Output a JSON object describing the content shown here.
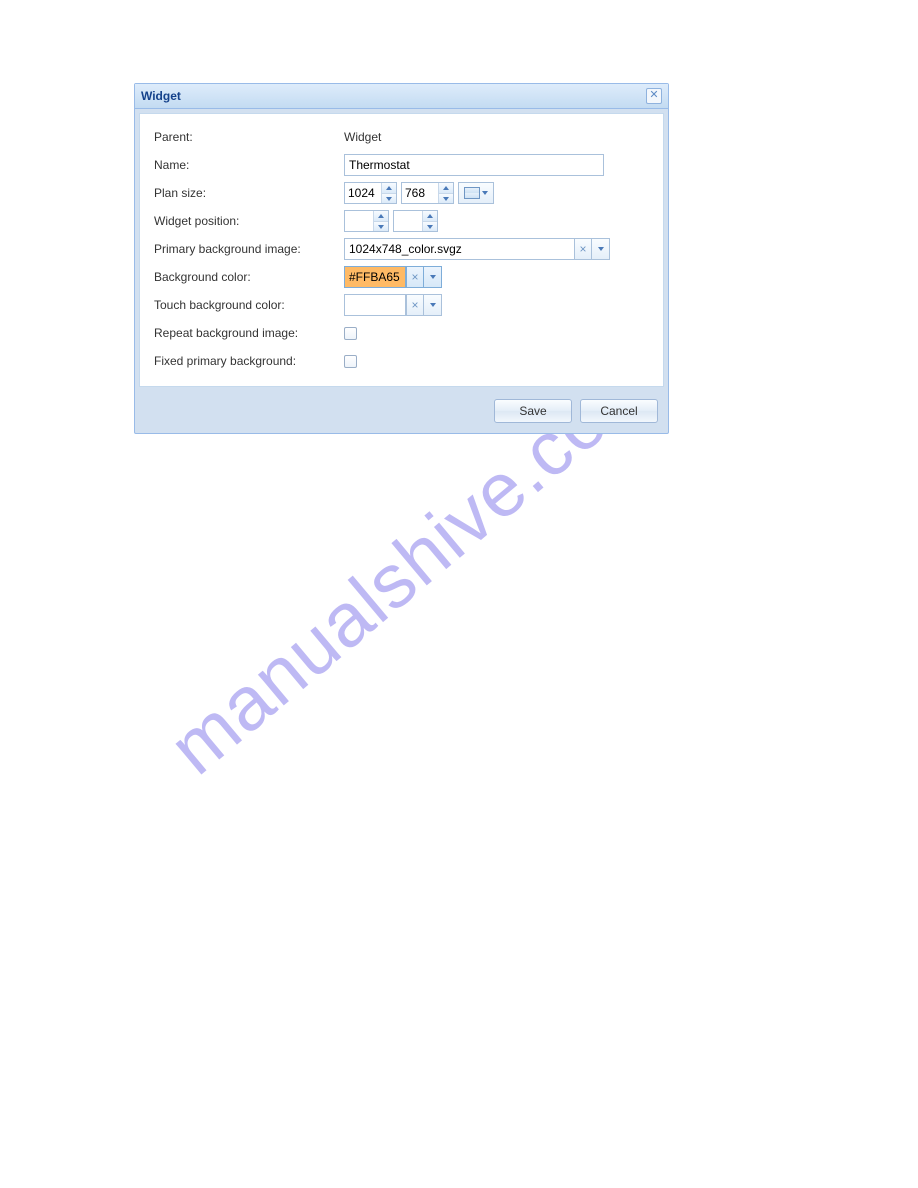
{
  "watermark": "manualshive.com",
  "dialog": {
    "title": "Widget",
    "labels": {
      "parent": "Parent:",
      "name": "Name:",
      "plan_size": "Plan size:",
      "widget_position": "Widget position:",
      "primary_bg_image": "Primary background image:",
      "bg_color": "Background color:",
      "touch_bg_color": "Touch background color:",
      "repeat_bg_image": "Repeat background image:",
      "fixed_primary_bg": "Fixed primary background:"
    },
    "values": {
      "parent": "Widget",
      "name": "Thermostat",
      "plan_width": "1024",
      "plan_height": "768",
      "pos_x": "",
      "pos_y": "",
      "primary_bg_image": "1024x748_color.svgz",
      "bg_color": "#FFBA65",
      "touch_bg_color": "",
      "repeat_bg_image": false,
      "fixed_primary_bg": false
    },
    "buttons": {
      "save": "Save",
      "cancel": "Cancel"
    }
  },
  "colors": {
    "bg_color_swatch": "#FFBA65"
  }
}
